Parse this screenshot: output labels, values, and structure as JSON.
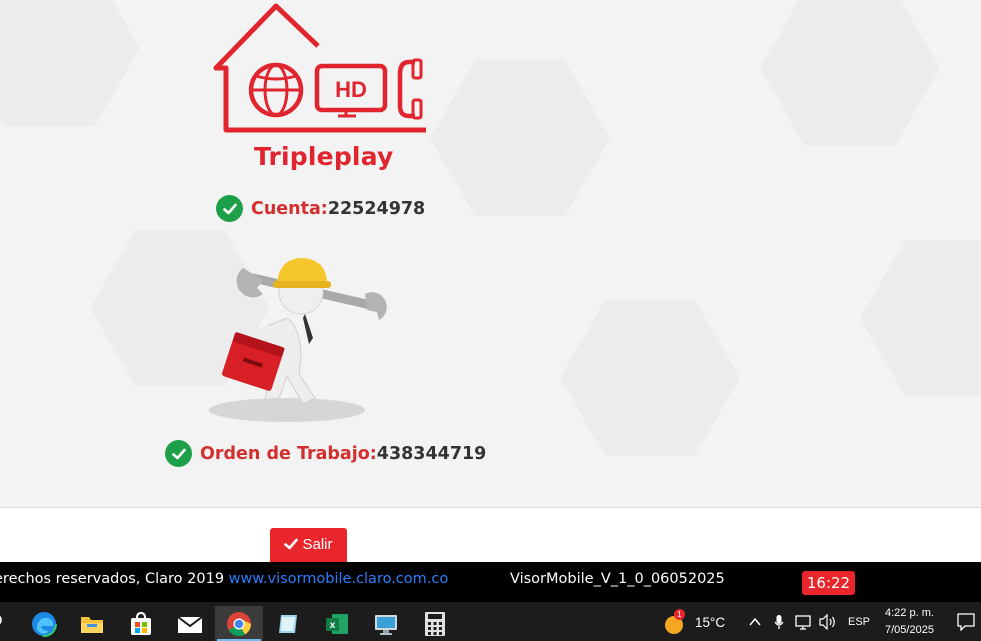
{
  "brand": {
    "name": "Tripleplay",
    "logo_text": "HD"
  },
  "account": {
    "label": "Cuenta:",
    "value": "22524978"
  },
  "work_order": {
    "label": "Orden de Trabajo:",
    "value": "438344719"
  },
  "actions": {
    "exit_label": "Salir"
  },
  "footer": {
    "copyright": "erechos reservados, Claro 2019 ",
    "link": "www.visormobile.claro.com.co",
    "version": "VisorMobile_V_1_0_06052025",
    "clock": "16:22"
  },
  "taskbar": {
    "apps": [
      "edge-icon",
      "file-explorer-icon",
      "store-icon",
      "mail-icon",
      "chrome-icon",
      "notes-icon",
      "excel-icon",
      "remote-desktop-icon",
      "calculator-icon"
    ],
    "weather_badge": "1",
    "temperature": "15°C",
    "language": "ESP",
    "time": "4:22 p. m.",
    "date": "7/05/2025"
  },
  "colors": {
    "accent": "#e1252e",
    "success": "#1ea04a",
    "link": "#2a7fff"
  }
}
